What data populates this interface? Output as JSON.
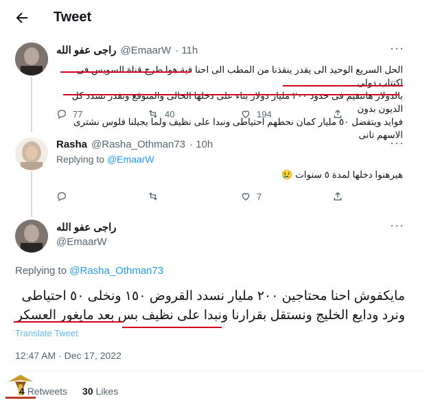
{
  "header": {
    "title": "Tweet"
  },
  "tweet1": {
    "name": "راجى عفو الله",
    "handle": "@EmaarW",
    "time": "· 11h",
    "lines": [
      "الحل السريع الوحيد الى يقدر ينقذنا من المطب الى احنا فية هوا طرح قناة السويس فى اكتتاب دولى",
      "بالدولار هانتقيم فى حدود ٢٠٠ مليار دولار بناء على دخلها الحالى والمتوقع ونقدر نسدد كل الديون بدون",
      "فوايد ويتفضل ٥٠ مليار كمان نحطهم احتياطى ونبدا على نظيف ولما يجيلنا فلوس نشترى الاسهم تانى"
    ],
    "reply_count": "77",
    "retweet_count": "40",
    "like_count": "194"
  },
  "tweet2": {
    "name": "Rasha",
    "handle": "@Rasha_Othman73",
    "time": "· 10h",
    "replying_label": "Replying to",
    "replying_to": "@EmaarW",
    "text": "هيرهنوا دخلها لمدة ٥ سنوات 😢",
    "reply_count": "",
    "retweet_count": "",
    "like_count": "7"
  },
  "main": {
    "name": "راجى عفو الله",
    "handle": "@EmaarW",
    "replying_label": "Replying to",
    "replying_to": "@Rasha_Othman73",
    "line1": "مايكفوش احنا محتاجين ٢٠٠ مليار نسدد القروض ١٥٠ ونخلى ٥٠ احتياطى",
    "line2": "ونرد ودايع الخليج ونستقل بقرارنا ونبدا على نظيف بس بعد مايغور العسكر",
    "translate": "Translate Tweet",
    "timestamp": "12:47 AM · Dec 17, 2022",
    "retweets_num": "4",
    "retweets_label": "Retweets",
    "likes_num": "30",
    "likes_label": "Likes"
  },
  "colors": {
    "accent": "#1d9bf0",
    "underline": "#d0021b",
    "muted": "#536471"
  }
}
